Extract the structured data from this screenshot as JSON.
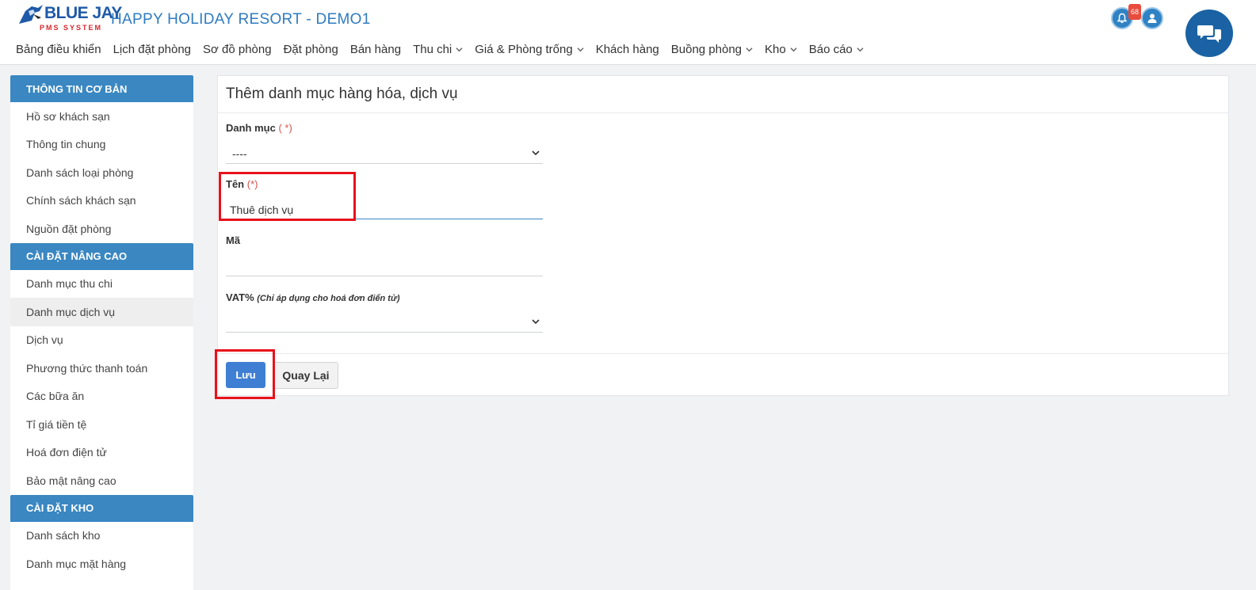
{
  "header": {
    "logo_text": "BLUE JAY",
    "logo_sub": "PMS SYSTEM",
    "app_title": "HAPPY HOLIDAY RESORT - DEMO1",
    "notification_count": "68",
    "nav": [
      {
        "label": "Bảng điều khiển",
        "dropdown": false
      },
      {
        "label": "Lịch đặt phòng",
        "dropdown": false
      },
      {
        "label": "Sơ đồ phòng",
        "dropdown": false
      },
      {
        "label": "Đặt phòng",
        "dropdown": false
      },
      {
        "label": "Bán hàng",
        "dropdown": false
      },
      {
        "label": "Thu chi",
        "dropdown": true
      },
      {
        "label": "Giá & Phòng trống",
        "dropdown": true
      },
      {
        "label": "Khách hàng",
        "dropdown": false
      },
      {
        "label": "Buồng phòng",
        "dropdown": true
      },
      {
        "label": "Kho",
        "dropdown": true
      },
      {
        "label": "Báo cáo",
        "dropdown": true
      }
    ]
  },
  "sidebar": {
    "sections": [
      {
        "title": "THÔNG TIN CƠ BẢN",
        "items": [
          "Hồ sơ khách sạn",
          "Thông tin chung",
          "Danh sách loại phòng",
          "Chính sách khách sạn",
          "Nguồn đặt phòng"
        ]
      },
      {
        "title": "CÀI ĐẶT NÂNG CAO",
        "items": [
          "Danh mục thu chi",
          "Danh mục dịch vụ",
          "Dịch vụ",
          "Phương thức thanh toán",
          "Các bữa ăn",
          "Tỉ giá tiền tệ",
          "Hoá đơn điện tử",
          "Bảo mật nâng cao"
        ]
      },
      {
        "title": "CÀI ĐẶT KHO",
        "items": [
          "Danh sách kho",
          "Danh mục mặt hàng"
        ]
      }
    ],
    "active_item": "Danh mục dịch vụ"
  },
  "form": {
    "title": "Thêm danh mục hàng hóa, dịch vụ",
    "category_label": "Danh mục",
    "category_required": "( *)",
    "category_value": "----",
    "name_label": "Tên",
    "name_required": "(*)",
    "name_value": "Thuê dịch vụ",
    "code_label": "Mã",
    "code_value": "",
    "vat_label": "VAT%",
    "vat_hint": "(Chỉ áp dụng cho hoá đơn điển tử)",
    "vat_value": "",
    "save_label": "Lưu",
    "back_label": "Quay Lại"
  },
  "colors": {
    "accent": "#3a87c2",
    "primary_button": "#3f7fd3",
    "highlight": "#e8111b",
    "badge": "#e84c3d"
  }
}
